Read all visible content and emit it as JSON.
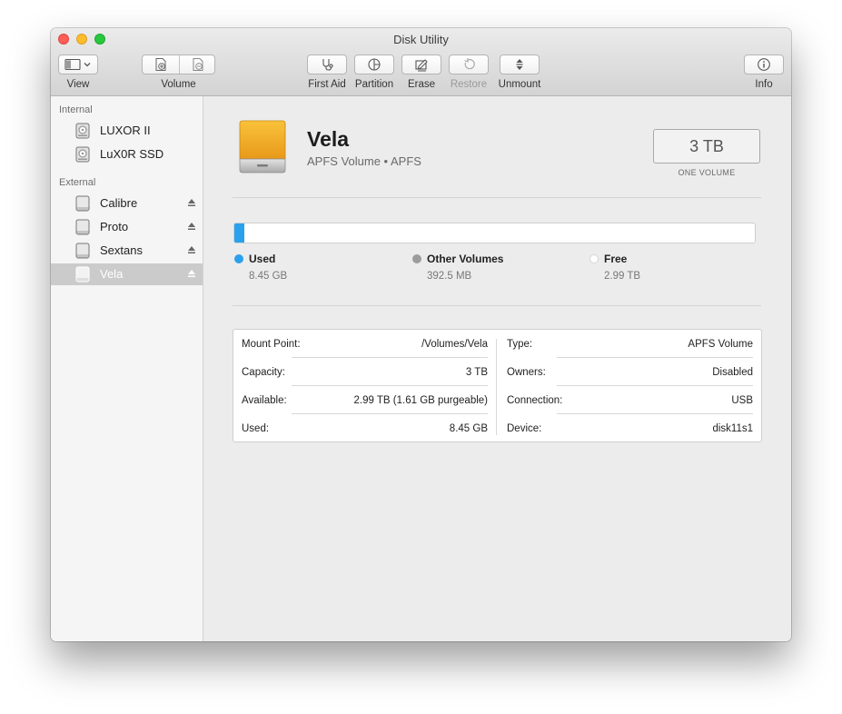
{
  "window": {
    "title": "Disk Utility"
  },
  "colors": {
    "used": "#2aa1ec",
    "other_volumes": "#9c9c9c",
    "free": "#ffffff",
    "selection": "#cbcbcb"
  },
  "toolbar": {
    "view_label": "View",
    "volume_label": "Volume",
    "first_aid_label": "First Aid",
    "partition_label": "Partition",
    "erase_label": "Erase",
    "restore_label": "Restore",
    "unmount_label": "Unmount",
    "info_label": "Info"
  },
  "sidebar": {
    "internal_header": "Internal",
    "external_header": "External",
    "internal_items": [
      {
        "label": "LUXOR II",
        "icon": "internal-disk-icon"
      },
      {
        "label": "LuX0R SSD",
        "icon": "internal-disk-icon"
      }
    ],
    "external_items": [
      {
        "label": "Calibre",
        "icon": "external-disk-icon",
        "eject": true
      },
      {
        "label": "Proto",
        "icon": "external-disk-icon",
        "eject": true
      },
      {
        "label": "Sextans",
        "icon": "external-disk-icon",
        "eject": true
      },
      {
        "label": "Vela",
        "icon": "external-disk-icon",
        "eject": true,
        "selected": true
      }
    ]
  },
  "volume": {
    "name": "Vela",
    "subtitle": "APFS Volume • APFS",
    "size": "3 TB",
    "size_caption": "ONE VOLUME"
  },
  "usage": {
    "used_fraction": 0.003,
    "legend": [
      {
        "name": "Used",
        "value": "8.45 GB"
      },
      {
        "name": "Other Volumes",
        "value": "392.5 MB"
      },
      {
        "name": "Free",
        "value": "2.99 TB"
      }
    ]
  },
  "info": {
    "left": [
      {
        "key": "Mount Point:",
        "value": "/Volumes/Vela"
      },
      {
        "key": "Capacity:",
        "value": "3 TB"
      },
      {
        "key": "Available:",
        "value": "2.99 TB (1.61 GB purgeable)"
      },
      {
        "key": "Used:",
        "value": "8.45 GB"
      }
    ],
    "right": [
      {
        "key": "Type:",
        "value": "APFS Volume"
      },
      {
        "key": "Owners:",
        "value": "Disabled"
      },
      {
        "key": "Connection:",
        "value": "USB"
      },
      {
        "key": "Device:",
        "value": "disk11s1"
      }
    ]
  }
}
